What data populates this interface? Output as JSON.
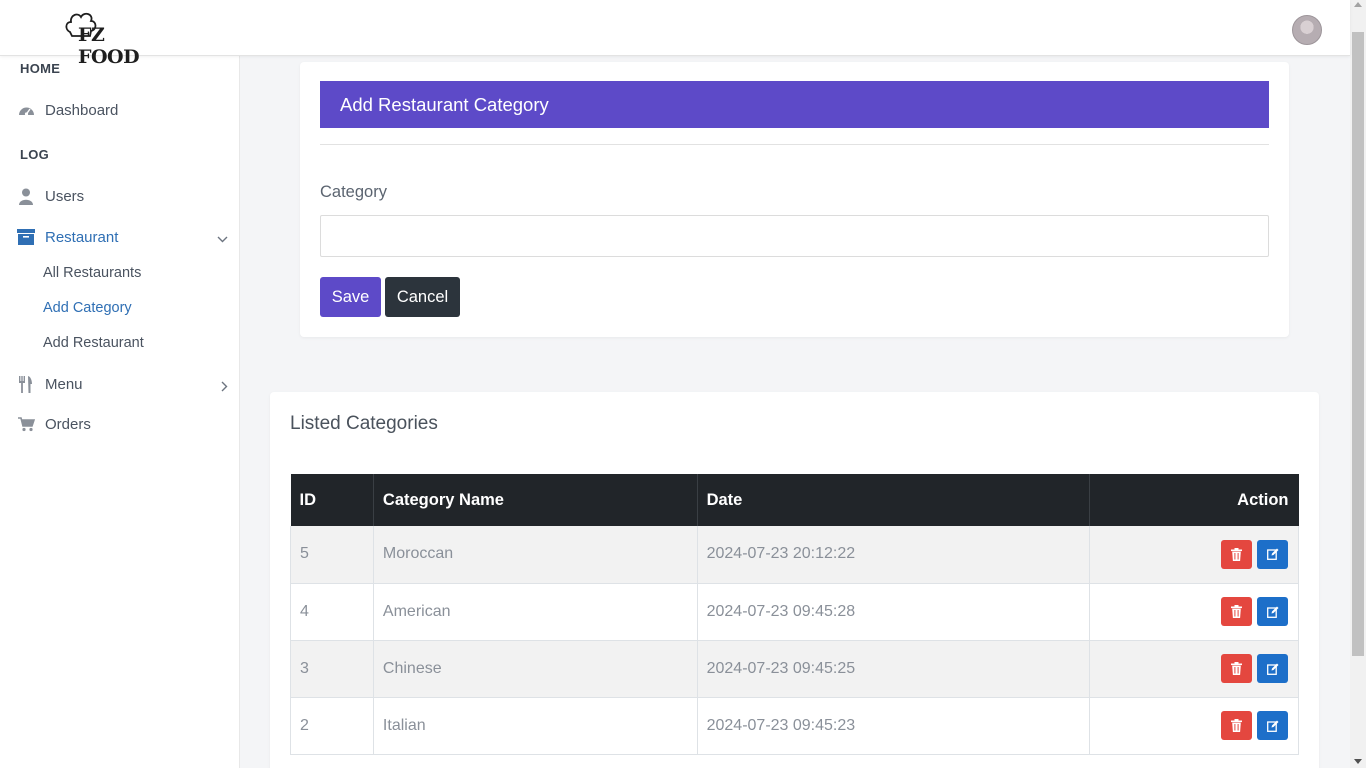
{
  "brand": {
    "logo_text": "FZ FOOD"
  },
  "sidebar": {
    "home_heading": "HOME",
    "log_heading": "LOG",
    "items": {
      "dashboard": "Dashboard",
      "users": "Users",
      "restaurant": "Restaurant",
      "menu": "Menu",
      "orders": "Orders"
    },
    "restaurant_sub": {
      "all": "All Restaurants",
      "add_category": "Add Category",
      "add_restaurant": "Add Restaurant"
    },
    "active_item": "Restaurant",
    "active_sub": "Add Category"
  },
  "form": {
    "title": "Add Restaurant Category",
    "category_label": "Category",
    "category_value": "",
    "save_label": "Save",
    "cancel_label": "Cancel"
  },
  "listing": {
    "title": "Listed Categories",
    "columns": {
      "id": "ID",
      "name": "Category Name",
      "date": "Date",
      "action": "Action"
    },
    "rows": [
      {
        "id": "5",
        "name": "Moroccan",
        "date": "2024-07-23 20:12:22"
      },
      {
        "id": "4",
        "name": "American",
        "date": "2024-07-23 09:45:28"
      },
      {
        "id": "3",
        "name": "Chinese",
        "date": "2024-07-23 09:45:25"
      },
      {
        "id": "2",
        "name": "Italian",
        "date": "2024-07-23 09:45:23"
      }
    ]
  },
  "icons": {
    "dashboard": "gauge-icon",
    "users": "user-icon",
    "restaurant": "archive-box-icon",
    "menu": "utensils-icon",
    "orders": "shopping-cart-icon",
    "delete": "trash-icon",
    "edit": "edit-icon"
  },
  "colors": {
    "accent": "#5d4ac8",
    "dark": "#212529",
    "delete": "#e4473f",
    "edit": "#1d6fc9",
    "link_active": "#2f6fb4"
  }
}
